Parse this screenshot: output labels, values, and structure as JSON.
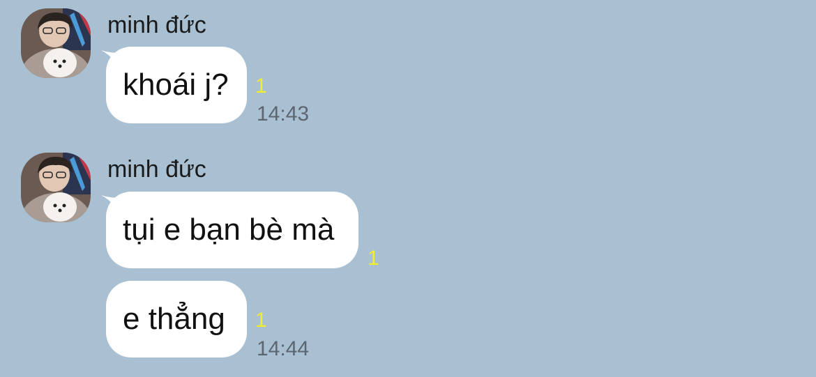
{
  "colors": {
    "background": "#a9bfd2",
    "bubble": "#ffffff",
    "read_count": "#f2ee2a",
    "timestamp": "#5c6670"
  },
  "messages": [
    {
      "sender": "minh đức",
      "avatar_icon": "user-avatar-with-dog",
      "text": "khoái j?",
      "read_count": "1",
      "time": "14:43"
    },
    {
      "sender": "minh đức",
      "avatar_icon": "user-avatar-with-dog",
      "text": "tụi e bạn bè mà",
      "read_count": "1"
    },
    {
      "text": "e thẳng",
      "read_count": "1",
      "time": "14:44"
    }
  ]
}
